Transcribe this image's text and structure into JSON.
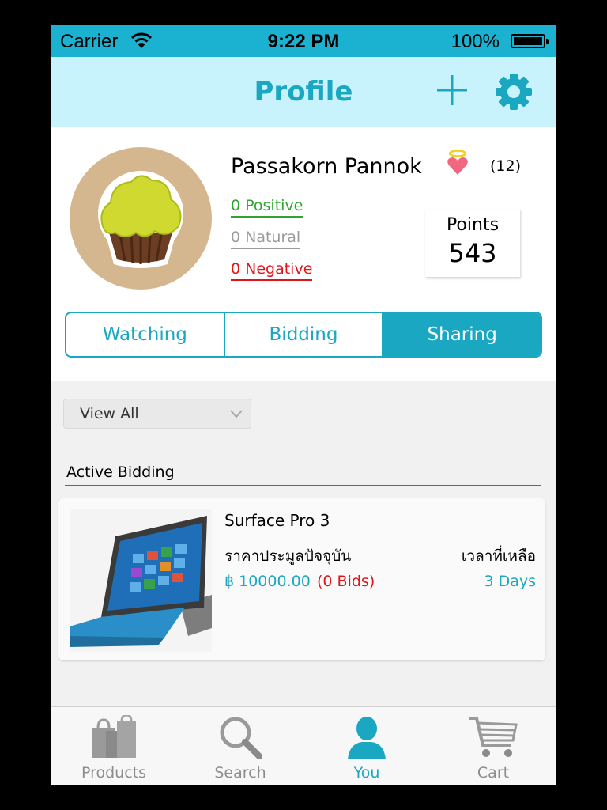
{
  "status_bar": {
    "carrier": "Carrier",
    "time": "9:22 PM",
    "battery": "100%"
  },
  "nav": {
    "title": "Profile",
    "add_icon": "plus-icon",
    "settings_icon": "gear-icon"
  },
  "profile": {
    "name": "Passakorn  Pannok",
    "rating_count": "(12)",
    "feedback": {
      "positive": "0  Positive",
      "natural": "0  Natural",
      "negative": "0  Negative"
    },
    "points_label": "Points",
    "points_value": "543"
  },
  "segments": [
    {
      "label": "Watching",
      "active": false
    },
    {
      "label": "Bidding",
      "active": false
    },
    {
      "label": "Sharing",
      "active": true
    }
  ],
  "filter": {
    "value": "View  All"
  },
  "section": {
    "title": "Active Bidding"
  },
  "items": [
    {
      "name": "Surface  Pro  3",
      "price_label": "ราคาประมูลปัจจุบัน",
      "time_label": "เวลาที่เหลือ",
      "price": "฿  10000.00",
      "bids": "(0  Bids)",
      "time_left": "3  Days"
    }
  ],
  "tabs": [
    {
      "label": "Products",
      "icon": "shopping-bags-icon",
      "active": false
    },
    {
      "label": "Search",
      "icon": "magnifier-icon",
      "active": false
    },
    {
      "label": "You",
      "icon": "person-icon",
      "active": true
    },
    {
      "label": "Cart",
      "icon": "cart-icon",
      "active": false
    }
  ],
  "colors": {
    "accent": "#1aa7c2",
    "status_bar": "#1bb1d0",
    "nav_bar": "#c8f2fc",
    "positive": "#2fa42f",
    "natural": "#9b9b9b",
    "negative": "#e0151b"
  }
}
